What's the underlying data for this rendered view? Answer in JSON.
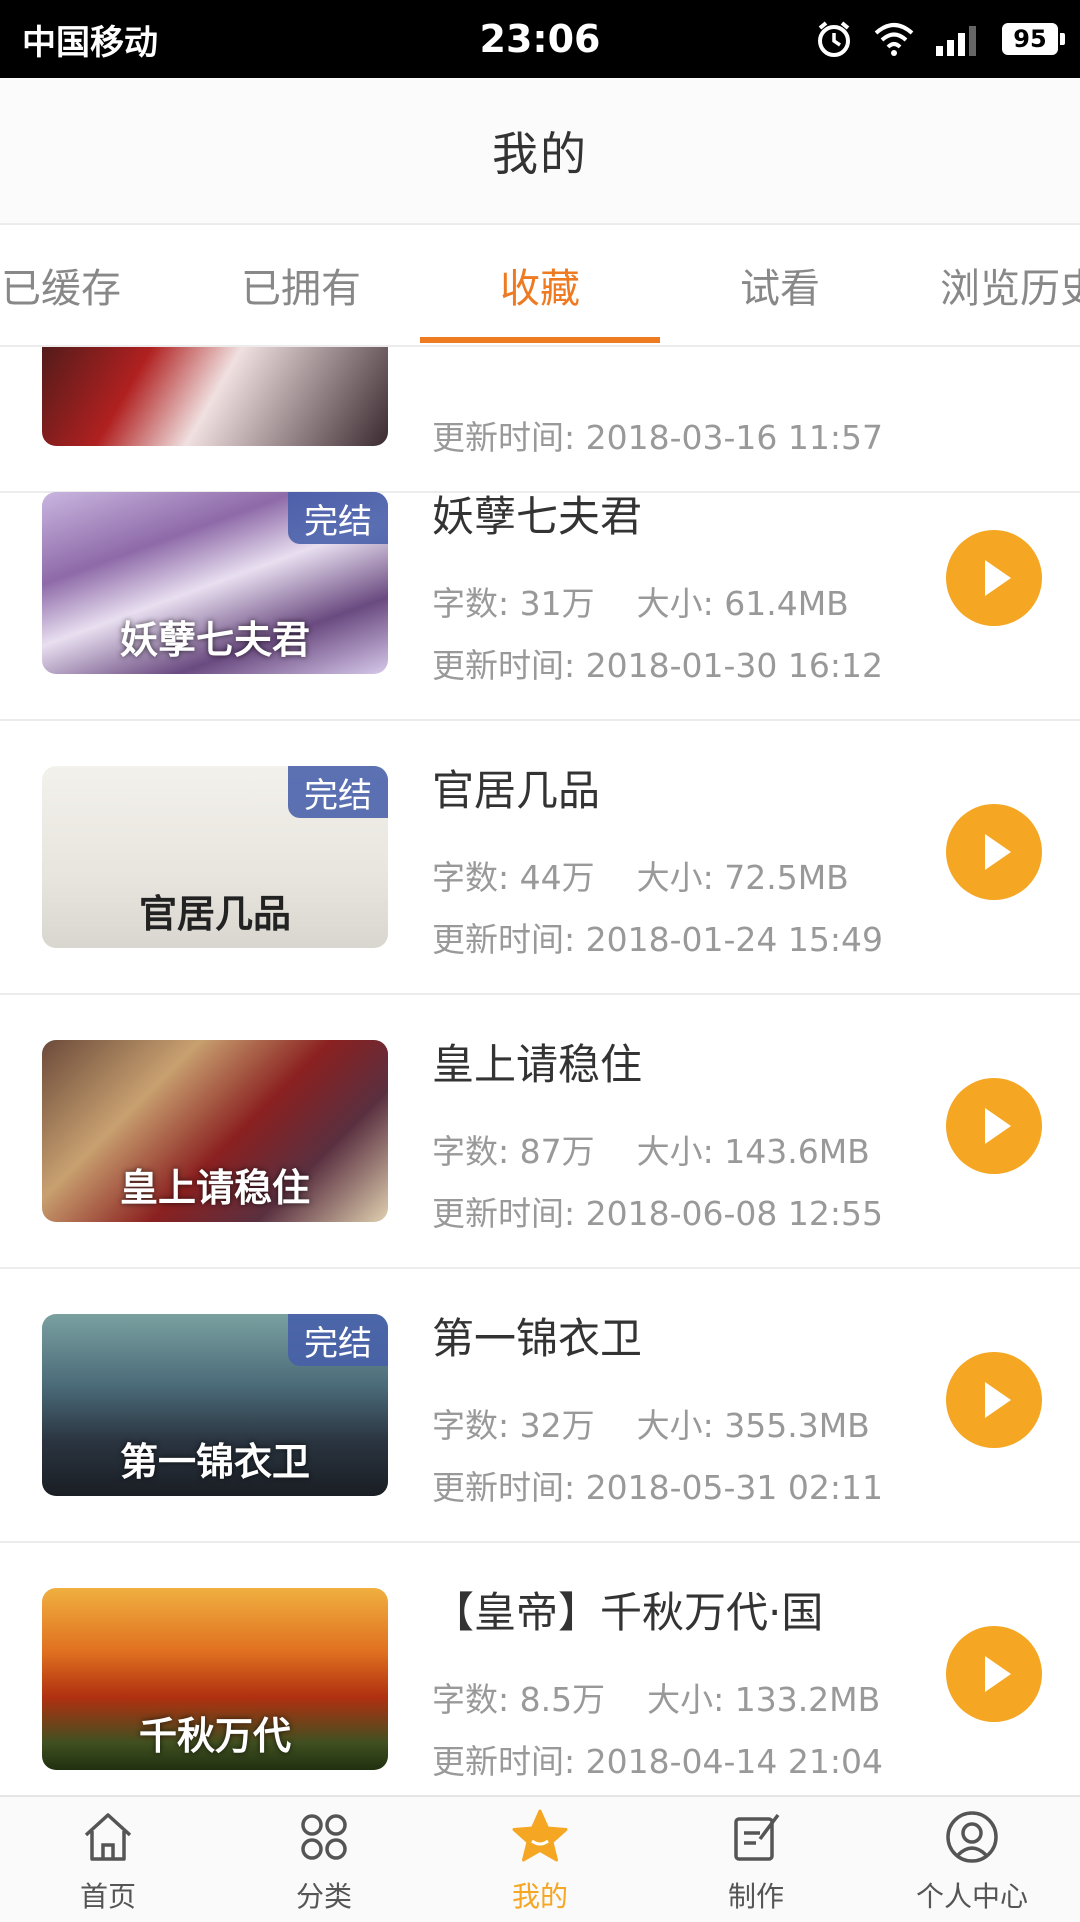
{
  "statusbar": {
    "carrier": "中国移动",
    "time": "23:06",
    "battery": "95",
    "icons": [
      "alarm-icon",
      "wifi-icon",
      "signal-icon",
      "battery-icon"
    ]
  },
  "header": {
    "title": "我的"
  },
  "tabs": [
    {
      "label": "已缓存",
      "active": false
    },
    {
      "label": "已拥有",
      "active": false
    },
    {
      "label": "收藏",
      "active": true
    },
    {
      "label": "试看",
      "active": false
    },
    {
      "label": "浏览历史",
      "active": false
    }
  ],
  "accent_color": "#ee7b22",
  "play_color": "#f5a623",
  "list": {
    "partial_item": {
      "updated": "更新时间: 2018-03-16 11:57"
    },
    "items": [
      {
        "title": "妖孽七夫君",
        "words": "字数: 31万",
        "size": "大小: 61.4MB",
        "updated": "更新时间: 2018-01-30 16:12",
        "badge": "完结",
        "cover_text": "妖孽七夫君"
      },
      {
        "title": "官居几品",
        "words": "字数: 44万",
        "size": "大小: 72.5MB",
        "updated": "更新时间: 2018-01-24 15:49",
        "badge": "完结",
        "cover_text": "官居几品"
      },
      {
        "title": "皇上请稳住",
        "words": "字数: 87万",
        "size": "大小: 143.6MB",
        "updated": "更新时间: 2018-06-08 12:55",
        "badge": "",
        "cover_text": "皇上请稳住"
      },
      {
        "title": "第一锦衣卫",
        "words": "字数: 32万",
        "size": "大小: 355.3MB",
        "updated": "更新时间: 2018-05-31 02:11",
        "badge": "完结",
        "cover_text": "第一锦衣卫"
      },
      {
        "title": "【皇帝】千秋万代·国",
        "words": "字数: 8.5万",
        "size": "大小: 133.2MB",
        "updated": "更新时间: 2018-04-14 21:04",
        "badge": "",
        "cover_text": "千秋万代"
      }
    ]
  },
  "bottomnav": [
    {
      "label": "首页",
      "icon": "home-icon",
      "active": false
    },
    {
      "label": "分类",
      "icon": "category-icon",
      "active": false
    },
    {
      "label": "我的",
      "icon": "star-icon",
      "active": true
    },
    {
      "label": "制作",
      "icon": "edit-icon",
      "active": false
    },
    {
      "label": "个人中心",
      "icon": "profile-icon",
      "active": false
    }
  ]
}
